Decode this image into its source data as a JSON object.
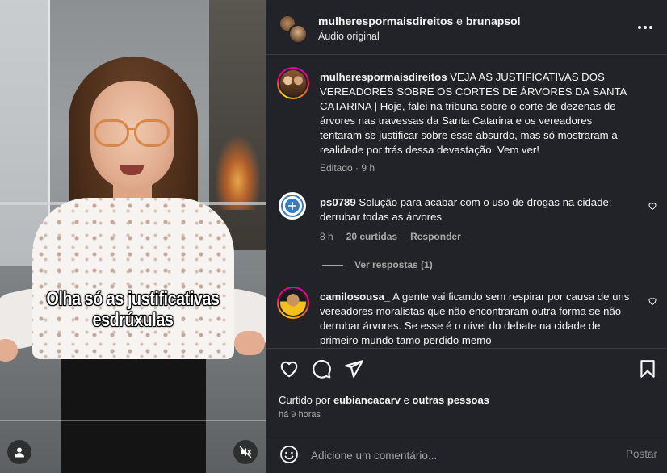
{
  "video": {
    "caption_line1": "Olha só as justificativas",
    "caption_line2": "esdrúxulas",
    "progress": 0.0
  },
  "header": {
    "user1": "mulherespormaisdireitos",
    "conjunction": "e",
    "user2": "brunapsol",
    "audio": "Áudio original"
  },
  "post": {
    "username": "mulherespormaisdireitos",
    "caption": "VEJA AS JUSTIFICATIVAS DOS VEREADORES SOBRE OS CORTES DE ÁRVORES DA SANTA CATARINA | Hoje, falei na tribuna sobre o corte de dezenas de árvores nas travessas da Santa Catarina e os vereadores tentaram se justificar sobre esse absurdo, mas só mostraram a realidade por trás dessa devastação. Vem ver!",
    "meta": "Editado · 9 h"
  },
  "comments": [
    {
      "username": "ps0789",
      "text": "Solução para acabar com o uso de drogas na cidade: derrubar todas as árvores",
      "time": "8 h",
      "likes": "20 curtidas",
      "reply": "Responder",
      "view_replies": "Ver respostas (1)"
    },
    {
      "username": "camilosousa_",
      "text": "A gente vai ficando sem respirar por causa de uns vereadores moralistas que não encontraram outra forma se não derrubar árvores. Se esse é o nível do debate na cidade de primeiro mundo tamo perdido memo"
    }
  ],
  "likes": {
    "prefix": "Curtido por",
    "user": "eubiancacarv",
    "conjunction": "e",
    "others": "outras pessoas"
  },
  "timestamp": "há 9 horas",
  "composer": {
    "placeholder": "Adicione um comentário...",
    "post_label": "Postar"
  },
  "icons": [
    "heart-icon",
    "comment-icon",
    "share-icon",
    "bookmark-icon",
    "more-icon",
    "emoji-icon",
    "user-icon",
    "mute-icon"
  ],
  "colors": {
    "panel_bg": "#212328",
    "text": "#f5f5f5",
    "muted": "#a8a8a8",
    "divider": "#3a3c41"
  }
}
